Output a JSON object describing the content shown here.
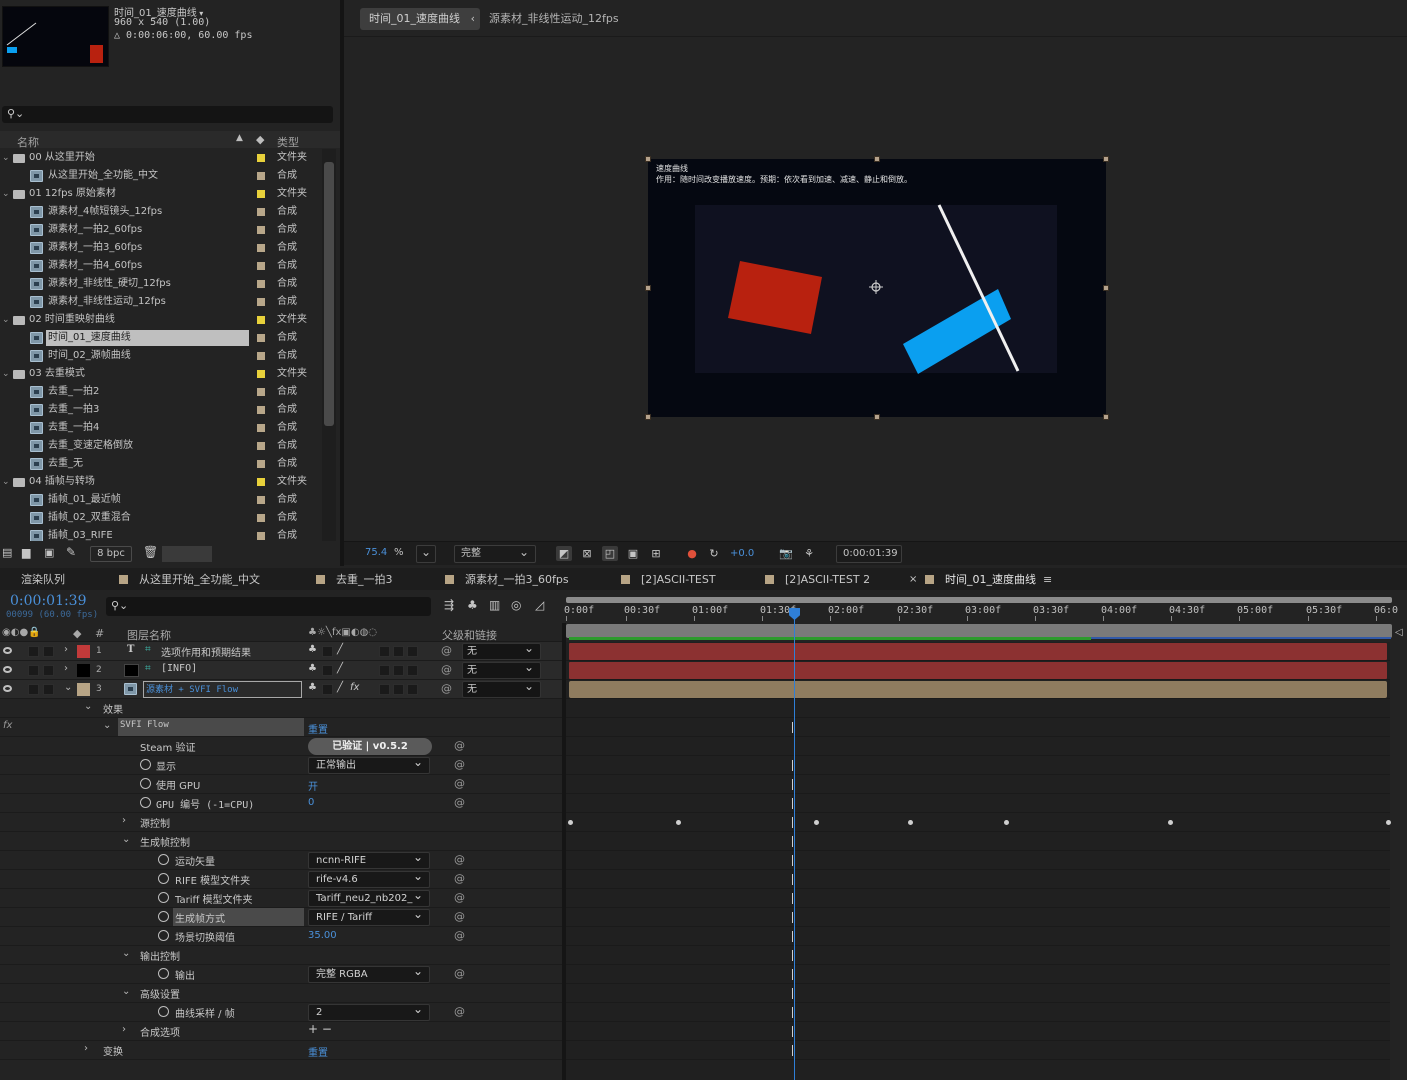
{
  "project": {
    "comp_name": "时间_01_速度曲线",
    "comp_size": "960 x 540 (1.00)",
    "comp_duration": "△ 0:00:06:00, 60.00 fps",
    "search_placeholder": "",
    "col_name": "名称",
    "col_type": "类型",
    "bpc": "8 bpc",
    "items": [
      {
        "name": "00 从这里开始",
        "type": "文件夹",
        "kind": "folder",
        "indent": 0,
        "label": "#e8d13b"
      },
      {
        "name": "从这里开始_全功能_中文",
        "type": "合成",
        "kind": "comp",
        "indent": 1,
        "label": "#b8a78a"
      },
      {
        "name": "01 12fps 原始素材",
        "type": "文件夹",
        "kind": "folder",
        "indent": 0,
        "label": "#e8d13b"
      },
      {
        "name": "源素材_4帧短镜头_12fps",
        "type": "合成",
        "kind": "comp",
        "indent": 1,
        "label": "#b8a78a"
      },
      {
        "name": "源素材_一拍2_60fps",
        "type": "合成",
        "kind": "comp",
        "indent": 1,
        "label": "#b8a78a"
      },
      {
        "name": "源素材_一拍3_60fps",
        "type": "合成",
        "kind": "comp",
        "indent": 1,
        "label": "#b8a78a"
      },
      {
        "name": "源素材_一拍4_60fps",
        "type": "合成",
        "kind": "comp",
        "indent": 1,
        "label": "#b8a78a"
      },
      {
        "name": "源素材_非线性_硬切_12fps",
        "type": "合成",
        "kind": "comp",
        "indent": 1,
        "label": "#b8a78a"
      },
      {
        "name": "源素材_非线性运动_12fps",
        "type": "合成",
        "kind": "comp",
        "indent": 1,
        "label": "#b8a78a"
      },
      {
        "name": "02 时间重映射曲线",
        "type": "文件夹",
        "kind": "folder",
        "indent": 0,
        "label": "#e8d13b"
      },
      {
        "name": "时间_01_速度曲线",
        "type": "合成",
        "kind": "comp",
        "indent": 1,
        "label": "#b8a78a",
        "selected": true
      },
      {
        "name": "时间_02_源帧曲线",
        "type": "合成",
        "kind": "comp",
        "indent": 1,
        "label": "#b8a78a"
      },
      {
        "name": "03 去重模式",
        "type": "文件夹",
        "kind": "folder",
        "indent": 0,
        "label": "#e8d13b"
      },
      {
        "name": "去重_一拍2",
        "type": "合成",
        "kind": "comp",
        "indent": 1,
        "label": "#b8a78a"
      },
      {
        "name": "去重_一拍3",
        "type": "合成",
        "kind": "comp",
        "indent": 1,
        "label": "#b8a78a"
      },
      {
        "name": "去重_一拍4",
        "type": "合成",
        "kind": "comp",
        "indent": 1,
        "label": "#b8a78a"
      },
      {
        "name": "去重_变速定格倒放",
        "type": "合成",
        "kind": "comp",
        "indent": 1,
        "label": "#b8a78a"
      },
      {
        "name": "去重_无",
        "type": "合成",
        "kind": "comp",
        "indent": 1,
        "label": "#b8a78a"
      },
      {
        "name": "04 插帧与转场",
        "type": "文件夹",
        "kind": "folder",
        "indent": 0,
        "label": "#e8d13b"
      },
      {
        "name": "插帧_01_最近帧",
        "type": "合成",
        "kind": "comp",
        "indent": 1,
        "label": "#b8a78a"
      },
      {
        "name": "插帧_02_双重混合",
        "type": "合成",
        "kind": "comp",
        "indent": 1,
        "label": "#b8a78a"
      },
      {
        "name": "插帧_03_RIFE",
        "type": "合成",
        "kind": "comp",
        "indent": 1,
        "label": "#b8a78a"
      }
    ]
  },
  "viewer": {
    "crumb_active": "时间_01_速度曲线",
    "crumb_next": "源素材_非线性运动_12fps",
    "frame_title": "速度曲线",
    "frame_desc": "作用：随时间改变播放速度。预期：依次看到加速、减速、静止和倒放。",
    "zoom": "75.4",
    "zoom_unit": "%",
    "resolution": "完整",
    "exposure": "+0.0",
    "timecode": "0:00:01:39",
    "red_rect_color": "#b8210f",
    "blue_rect_color": "#0a9ff0"
  },
  "timeline": {
    "tabs": [
      {
        "label": "渲染队列",
        "square": false
      },
      {
        "label": "从这里开始_全功能_中文",
        "square": true
      },
      {
        "label": "去重_一拍3",
        "square": true
      },
      {
        "label": "源素材_一拍3_60fps",
        "square": true
      },
      {
        "label": "[2]ASCII-TEST",
        "square": true
      },
      {
        "label": "[2]ASCII-TEST 2",
        "square": true
      },
      {
        "label": "时间_01_速度曲线",
        "square": true,
        "active": true
      }
    ],
    "close_mark": "×",
    "menu_mark": "≡",
    "timecode": "0:00:01:39",
    "frames": "00099 (60.00 fps)",
    "col_layer_name": "图层名称",
    "col_num": "#",
    "col_parent": "父级和链接",
    "ruler": [
      "0:00f",
      "00:30f",
      "01:00f",
      "01:30f",
      "02:00f",
      "02:30f",
      "03:00f",
      "03:30f",
      "04:00f",
      "04:30f",
      "05:00f",
      "05:30f",
      "06:0"
    ],
    "layers": [
      {
        "num": "1",
        "name": "选项作用和预期结果",
        "color": "#c23a3a",
        "kind": "text",
        "parent": "无"
      },
      {
        "num": "2",
        "name": "[INFO]",
        "color": "#000000",
        "kind": "solid",
        "parent": "无"
      },
      {
        "num": "3",
        "name": "源素材 + SVFI Flow",
        "color": "#b7a485",
        "kind": "comp",
        "parent": "无"
      }
    ],
    "effects_label": "效果",
    "fx_mark": "fx",
    "fx_name": "SVFI Flow",
    "reset": "重置",
    "steam_label": "Steam 验证",
    "steam_value": "已验证 | v0.5.2",
    "display_label": "显示",
    "display_value": "正常输出",
    "gpu_label": "使用 GPU",
    "gpu_value": "开",
    "gpu_id_label": "GPU 编号 (-1=CPU)",
    "gpu_id_value": "0",
    "source_ctrl": "源控制",
    "gen_ctrl": "生成帧控制",
    "motion_label": "运动矢量",
    "motion_value": "ncnn-RIFE",
    "rife_label": "RIFE 模型文件夹",
    "rife_value": "rife-v4.6",
    "tariff_label": "Tariff 模型文件夹",
    "tariff_value": "Tariff_neu2_nb202_",
    "gen_mode_label": "生成帧方式",
    "gen_mode_value": "RIFE / Tariff",
    "scene_label": "场景切换阈值",
    "scene_value": "35.00",
    "output_ctrl": "输出控制",
    "output_label": "输出",
    "output_value": "完整 RGBA",
    "advanced": "高级设置",
    "curve_label": "曲线采样 / 帧",
    "curve_value": "2",
    "comp_options": "合成选项",
    "comp_options_mark": "+ −",
    "transform": "变换",
    "transform_reset": "重置"
  }
}
